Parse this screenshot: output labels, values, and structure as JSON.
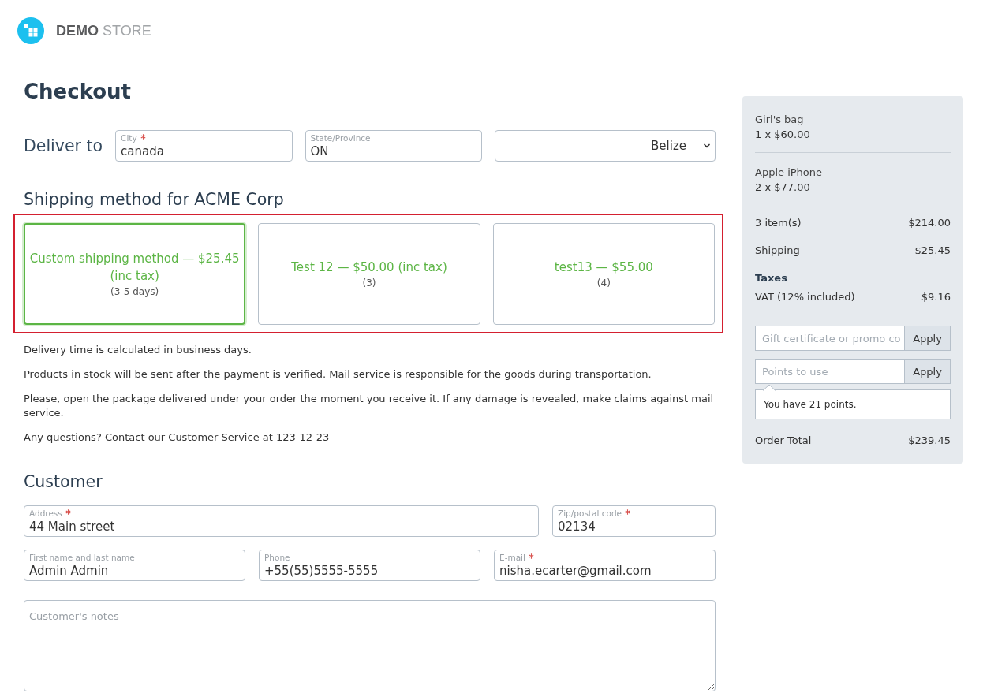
{
  "header": {
    "logo": {
      "bold": "DEMO",
      "light": "STORE"
    }
  },
  "page_title": "Checkout",
  "delivery": {
    "label": "Deliver to",
    "fields": [
      {
        "label": "City",
        "required": true,
        "value": "canada"
      },
      {
        "label": "State/Province",
        "required": false,
        "value": "ON"
      }
    ],
    "country": {
      "value": "Belize"
    }
  },
  "shipping": {
    "title": "Shipping method for ACME Corp",
    "highlighted": true,
    "methods": [
      {
        "name": "Custom shipping method — $25.45 (inc tax)",
        "note": "(3-5 days)",
        "selected": true
      },
      {
        "name": "Test 12 — $50.00 (inc tax)",
        "note": "(3)",
        "selected": false
      },
      {
        "name": "test13 — $55.00",
        "note": "(4)",
        "selected": false
      }
    ],
    "notes": [
      "Delivery time is calculated in business days.",
      "Products in stock will be sent after the payment is verified. Mail service is responsible for the goods during transportation.",
      "Please, open the package delivered under your order the moment you receive it. If any damage is revealed, make claims against mail service.",
      "Any questions? Contact our Customer Service at 123-12-23"
    ]
  },
  "customer": {
    "title": "Customer",
    "fields": [
      {
        "label": "Address",
        "required": true,
        "value": "44 Main street"
      },
      {
        "label": "Zip/postal code",
        "required": true,
        "value": "02134"
      },
      {
        "label": "First name and last name",
        "required": false,
        "value": "Admin Admin"
      },
      {
        "label": "Phone",
        "required": false,
        "value": "+55(55)5555-5555"
      },
      {
        "label": "E-mail",
        "required": true,
        "value": "nisha.ecarter@gmail.com"
      }
    ],
    "notes_field": {
      "placeholder": "Customer's notes"
    }
  },
  "summary": {
    "items": [
      {
        "name": "Girl's bag",
        "quantity_price": "1 x $60.00"
      },
      {
        "name": "Apple iPhone",
        "quantity_price": "2 x $77.00"
      }
    ],
    "rows": [
      {
        "label": "3 item(s)",
        "value": "$214.00"
      },
      {
        "label": "Shipping",
        "value": "$25.45"
      }
    ],
    "taxes": {
      "title": "Taxes",
      "rows": [
        {
          "label": "VAT (12% included)",
          "value": "$9.16"
        }
      ]
    },
    "promo": {
      "placeholder": "Gift certificate or promo co",
      "button": "Apply"
    },
    "points": {
      "placeholder": "Points to use",
      "button": "Apply",
      "hint": "You have 21 points."
    },
    "total": {
      "label": "Order Total",
      "value": "$239.45"
    }
  }
}
